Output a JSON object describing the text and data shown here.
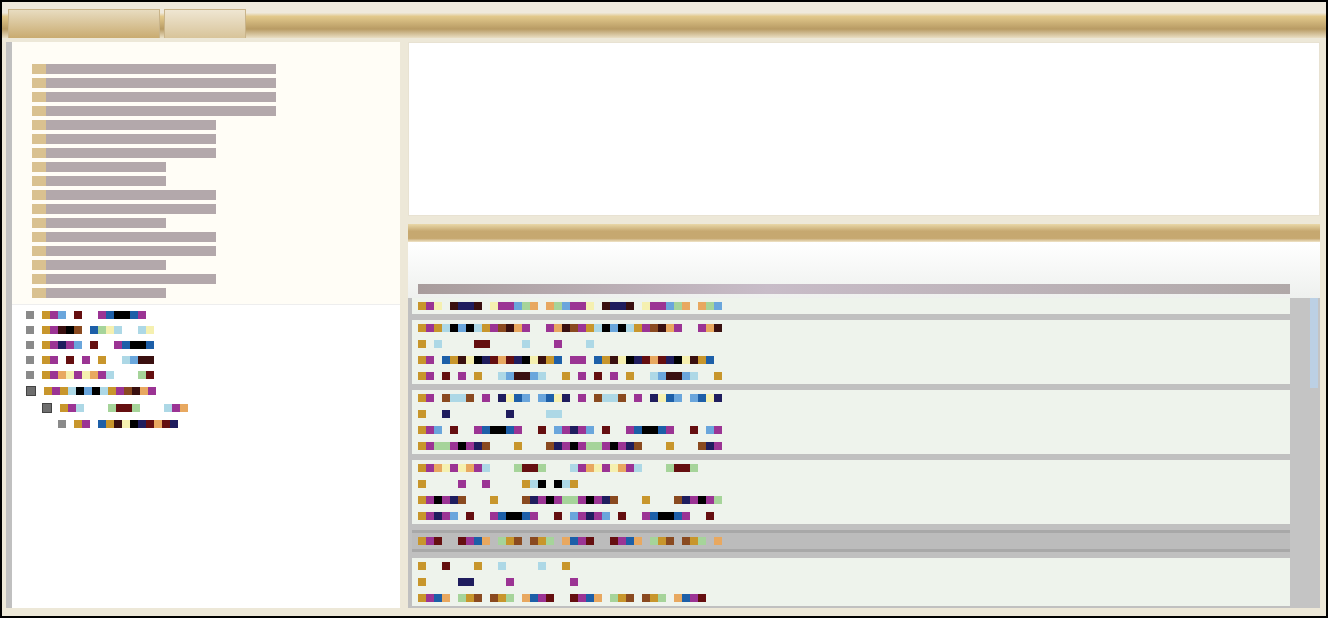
{
  "tabs": [
    {
      "selected": true
    },
    {
      "selected": false
    }
  ],
  "outline": {
    "items": [
      {
        "kind": "long"
      },
      {
        "kind": "long"
      },
      {
        "kind": "long"
      },
      {
        "kind": "long"
      },
      {
        "kind": "medium"
      },
      {
        "kind": "medium"
      },
      {
        "kind": "medium"
      },
      {
        "kind": "short"
      },
      {
        "kind": "short"
      },
      {
        "kind": "medium"
      },
      {
        "kind": "medium"
      },
      {
        "kind": "short"
      },
      {
        "kind": "medium"
      },
      {
        "kind": "medium"
      },
      {
        "kind": "short"
      },
      {
        "kind": "medium"
      },
      {
        "kind": "short"
      }
    ]
  },
  "tree": [
    {
      "expanded": false
    },
    {
      "expanded": false
    },
    {
      "expanded": false
    },
    {
      "expanded": false
    },
    {
      "expanded": false
    },
    {
      "expanded": true,
      "children": [
        {
          "expanded": true,
          "children": [
            {
              "expanded": false
            }
          ]
        }
      ]
    }
  ],
  "results": {
    "rows": [
      {
        "selected": false,
        "lines": [
          {
            "kind": "full"
          }
        ]
      },
      {
        "selected": false,
        "lines": [
          {
            "kind": "full"
          },
          {
            "kind": "sparse"
          },
          {
            "kind": "full"
          },
          {
            "kind": "full"
          }
        ]
      },
      {
        "selected": false,
        "lines": [
          {
            "kind": "full"
          },
          {
            "kind": "sparse"
          },
          {
            "kind": "full"
          },
          {
            "kind": "full"
          }
        ]
      },
      {
        "selected": false,
        "lines": [
          {
            "kind": "full"
          },
          {
            "kind": "sparse"
          },
          {
            "kind": "full"
          },
          {
            "kind": "full"
          }
        ]
      },
      {
        "selected": true,
        "lines": [
          {
            "kind": "full"
          }
        ]
      },
      {
        "selected": false,
        "lines": [
          {
            "kind": "sparse"
          },
          {
            "kind": "sparse"
          },
          {
            "kind": "full"
          }
        ]
      }
    ]
  }
}
